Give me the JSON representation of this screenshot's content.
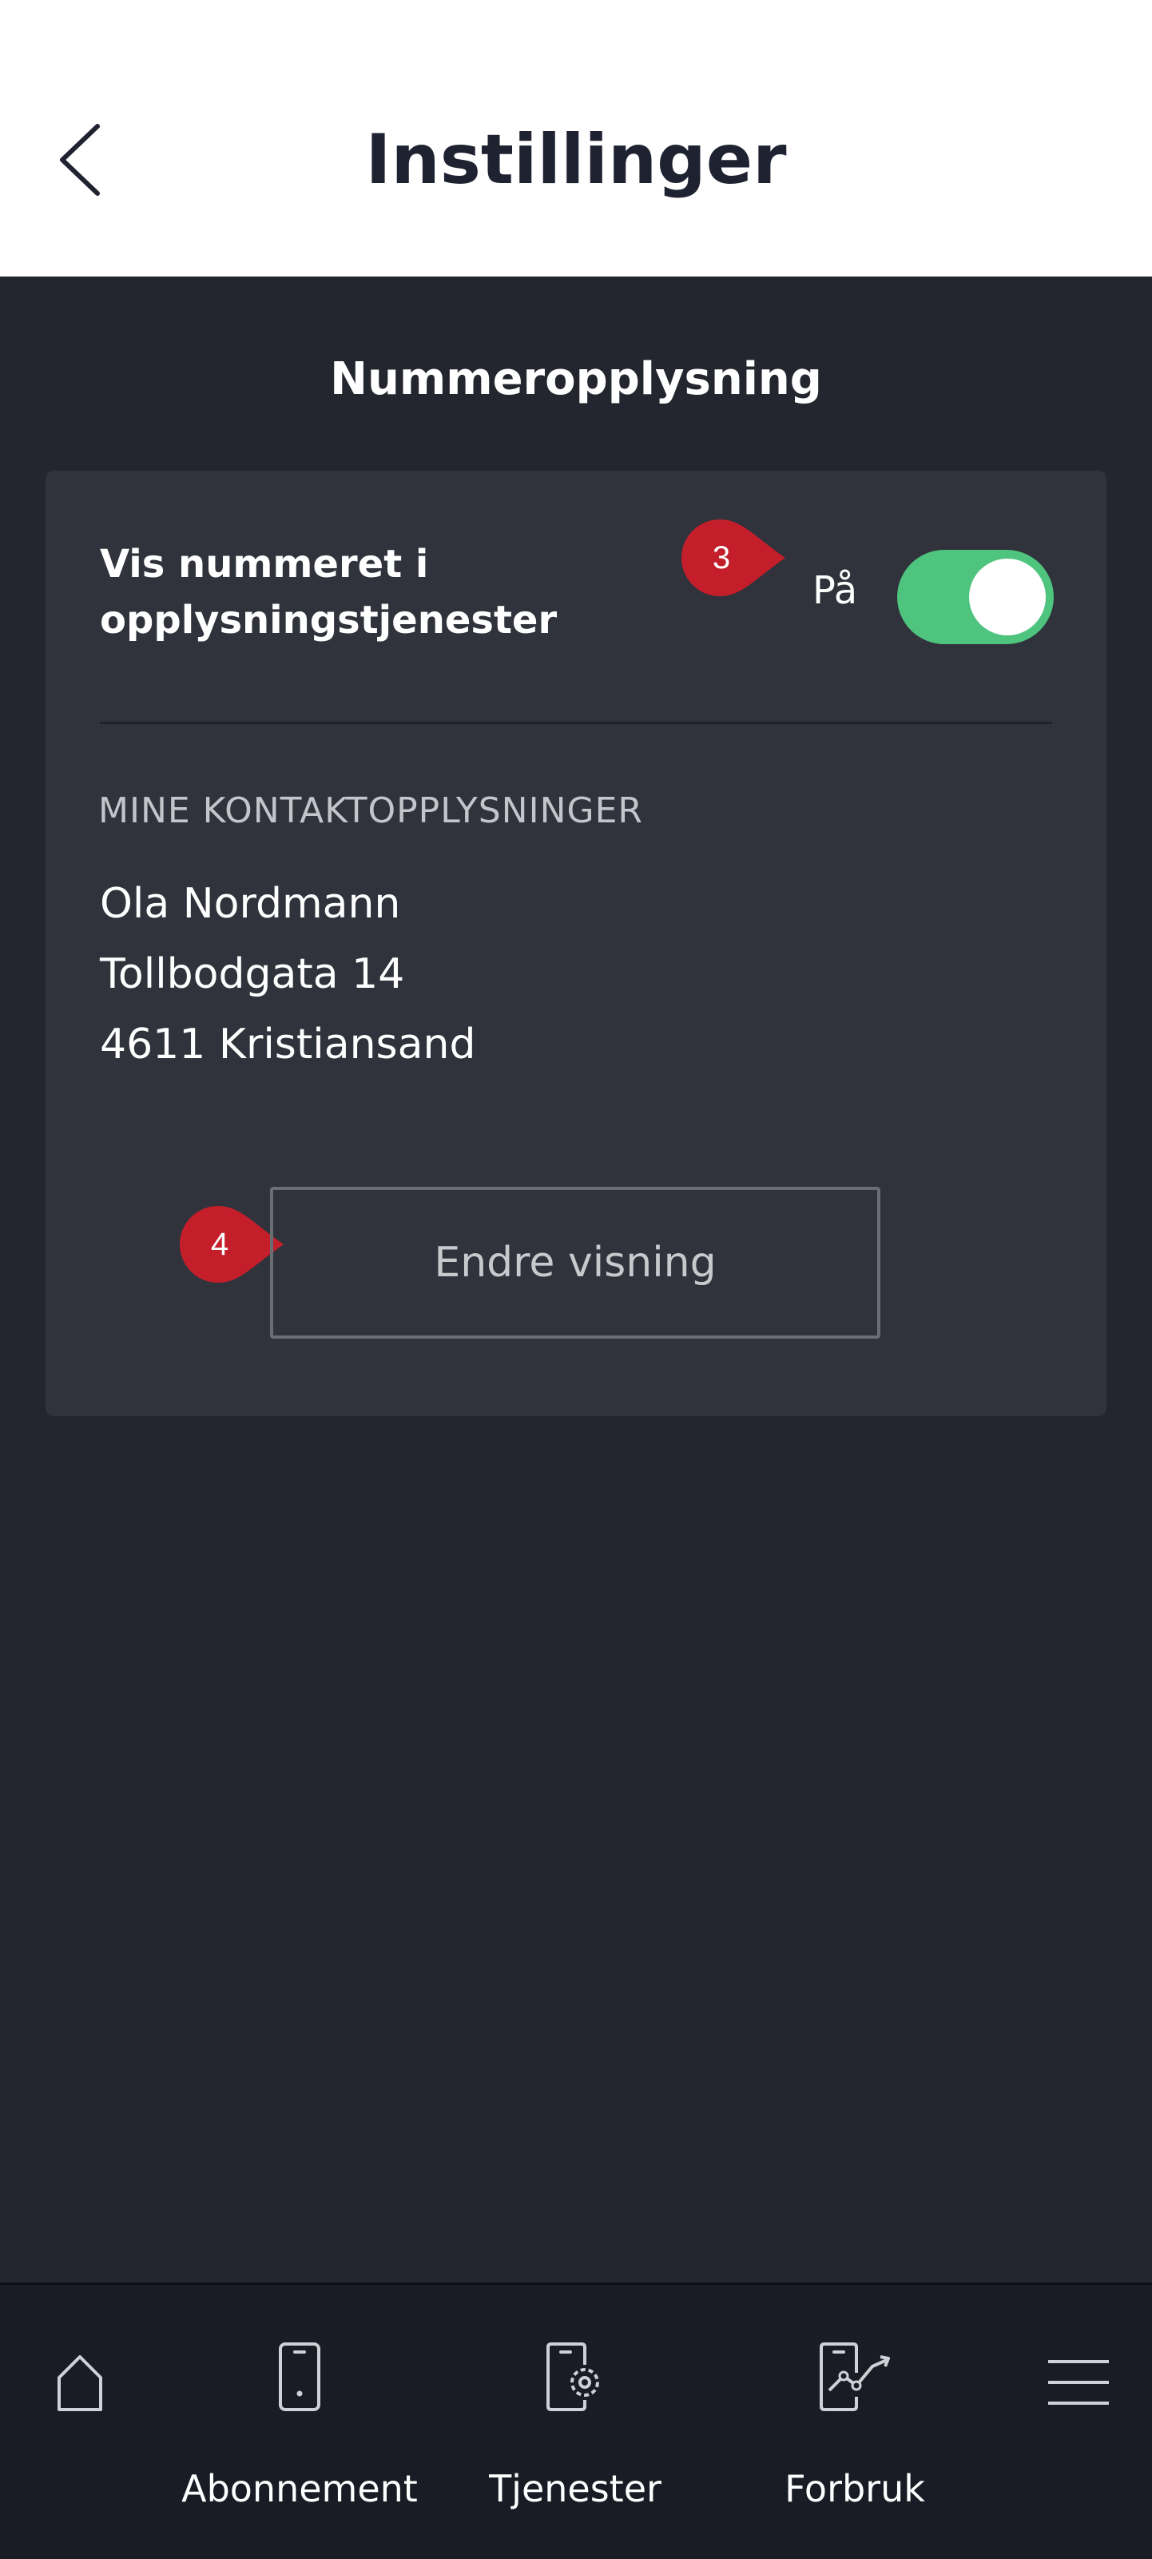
{
  "header": {
    "title": "Instillinger",
    "back_icon": "chevron-left-icon"
  },
  "section": {
    "title": "Nummeropplysning"
  },
  "toggle_row": {
    "label_line1": "Vis nummeret i",
    "label_line2": "opplysningstjenester",
    "state_text": "På",
    "enabled": true,
    "marker_number": "3",
    "accent_color": "#4ec47f"
  },
  "contact": {
    "heading": "MINE KONTAKTOPPLYSNINGER",
    "name": "Ola Nordmann",
    "street": "Tollbodgata 14",
    "city": "4611 Kristiansand"
  },
  "edit_button": {
    "label": "Endre visning",
    "marker_number": "4"
  },
  "marker_color": "#c41e2b",
  "bottom_nav": {
    "items": [
      {
        "label": "",
        "icon": "home-icon"
      },
      {
        "label": "Abonnement",
        "icon": "phone-icon"
      },
      {
        "label": "Tjenester",
        "icon": "phone-gear-icon"
      },
      {
        "label": "Forbruk",
        "icon": "phone-chart-icon"
      },
      {
        "label": "",
        "icon": "menu-icon"
      }
    ]
  }
}
